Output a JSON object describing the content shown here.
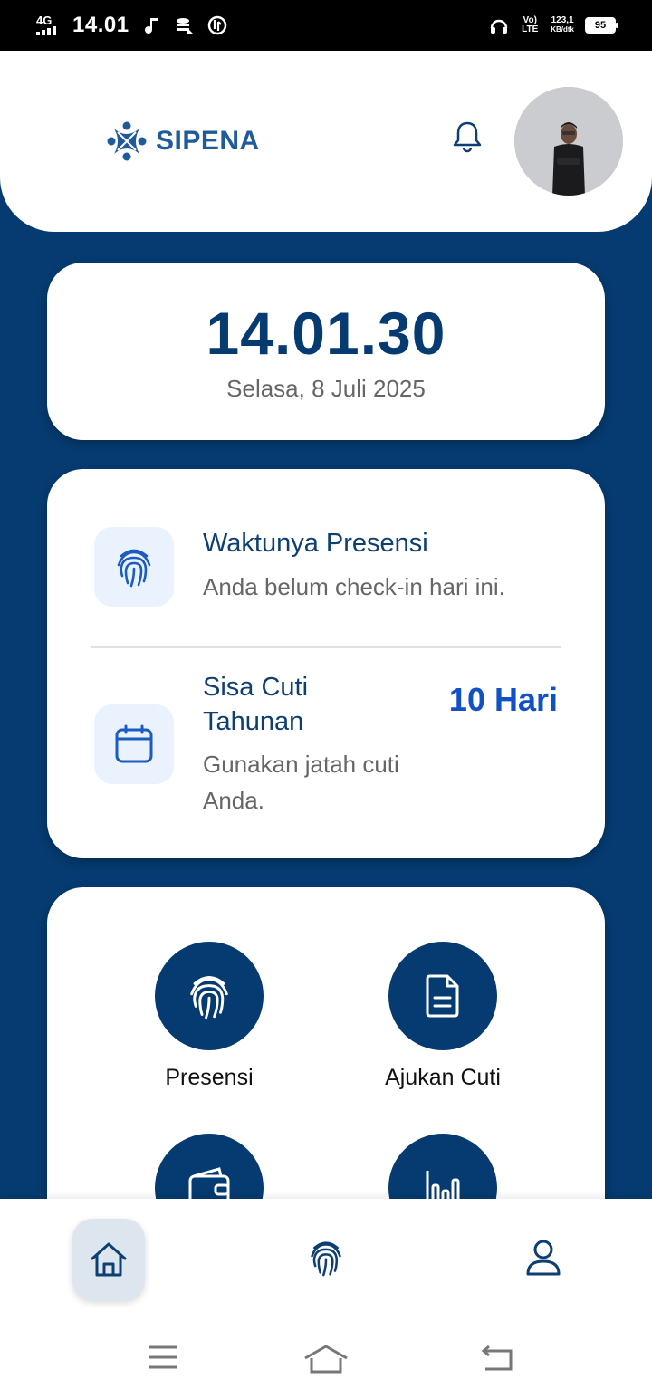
{
  "status_bar": {
    "network": "4G",
    "time": "14.01",
    "volte": "Vo) LTE",
    "speed": "123,1",
    "speed_unit": "KB/dtk",
    "battery": "95"
  },
  "header": {
    "app_name": "SIPENA"
  },
  "clock_card": {
    "time": "14.01.30",
    "date": "Selasa, 8 Juli 2025"
  },
  "attendance": {
    "title": "Waktunya Presensi",
    "subtitle": "Anda belum check-in hari ini."
  },
  "leave": {
    "title_line1": "Sisa Cuti",
    "title_line2": "Tahunan",
    "subtitle_line1": "Gunakan jatah cuti",
    "subtitle_line2": "Anda.",
    "days": "10 Hari"
  },
  "menu": {
    "items": [
      {
        "label": "Presensi",
        "icon": "fingerprint-icon"
      },
      {
        "label": "Ajukan Cuti",
        "icon": "document-icon"
      },
      {
        "label": "",
        "icon": "wallet-icon"
      },
      {
        "label": "",
        "icon": "bar-chart-icon"
      }
    ]
  },
  "bottom_nav": {
    "items": [
      "home-icon",
      "fingerprint-icon",
      "user-icon"
    ]
  },
  "colors": {
    "primary": "#053b70",
    "accent": "#1151c4",
    "icon_bg": "#e9f2fd"
  }
}
